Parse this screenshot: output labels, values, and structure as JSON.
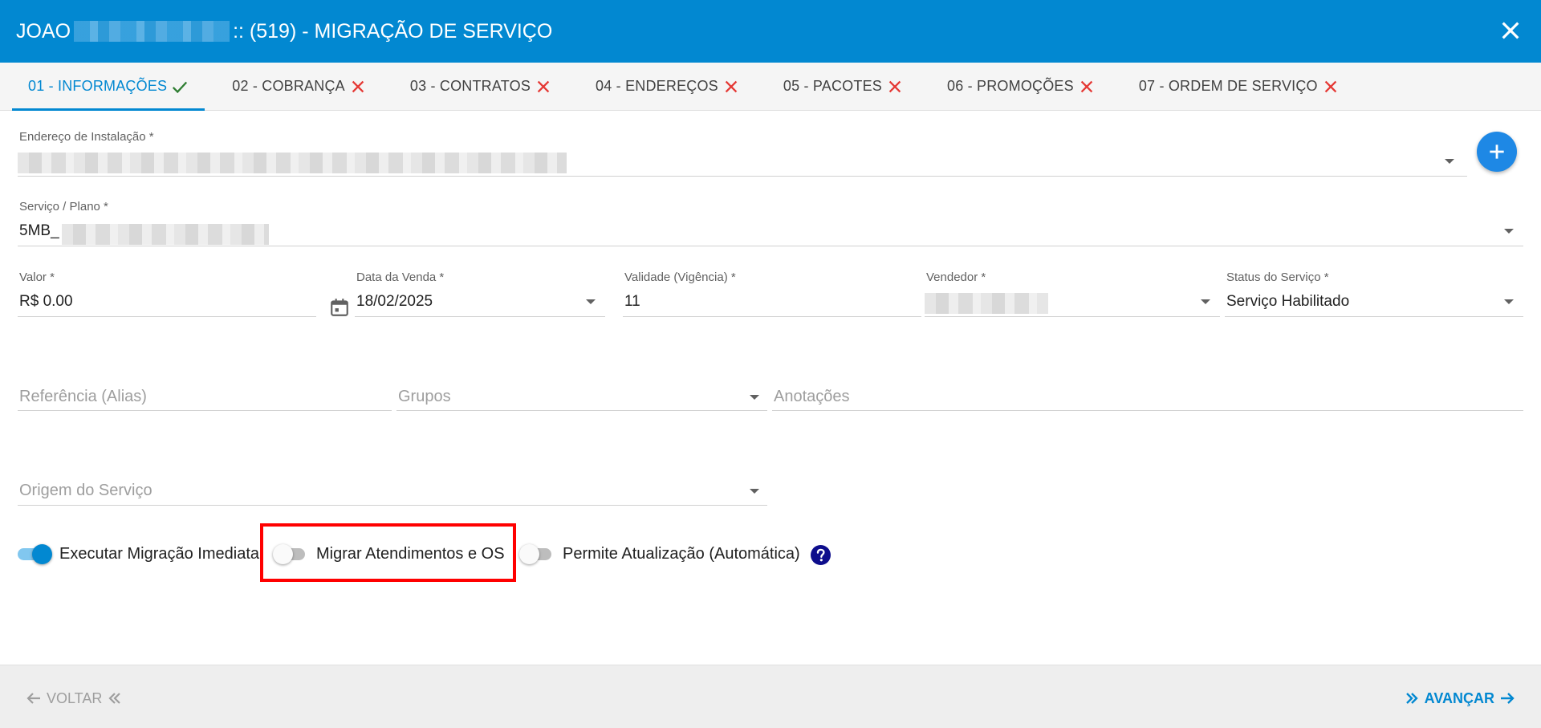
{
  "header": {
    "title_prefix": "JOAO",
    "title_suffix": ":: (519) - MIGRAÇÃO DE SERVIÇO"
  },
  "tabs": [
    {
      "label": "01 - INFORMAÇÕES",
      "status": "ok"
    },
    {
      "label": "02 - COBRANÇA",
      "status": "error"
    },
    {
      "label": "03 - CONTRATOS",
      "status": "error"
    },
    {
      "label": "04 - ENDEREÇOS",
      "status": "error"
    },
    {
      "label": "05 - PACOTES",
      "status": "error"
    },
    {
      "label": "06 - PROMOÇÕES",
      "status": "error"
    },
    {
      "label": "07 - ORDEM DE SERVIÇO",
      "status": "error"
    }
  ],
  "form": {
    "endereco": {
      "label": "Endereço de Instalação *",
      "value": ""
    },
    "servico": {
      "label": "Serviço / Plano *",
      "value": "5MB_"
    },
    "valor": {
      "label": "Valor *",
      "value": "R$ 0.00"
    },
    "data_venda": {
      "label": "Data da Venda *",
      "value": "18/02/2025"
    },
    "validade": {
      "label": "Validade (Vigência) *",
      "value": "11"
    },
    "vendedor": {
      "label": "Vendedor *",
      "value": ""
    },
    "status": {
      "label": "Status do Serviço *",
      "value": "Serviço Habilitado"
    },
    "referencia": {
      "placeholder": "Referência (Alias)"
    },
    "grupos": {
      "placeholder": "Grupos"
    },
    "anotacoes": {
      "placeholder": "Anotações"
    },
    "origem": {
      "placeholder": "Origem do Serviço"
    }
  },
  "toggles": [
    {
      "label": "Executar Migração Imediata",
      "on": true
    },
    {
      "label": "Migrar Atendimentos e OS",
      "on": false
    },
    {
      "label": "Permite Atualização (Automática)",
      "on": false
    }
  ],
  "footer": {
    "back_label": "VOLTAR",
    "next_label": "AVANÇAR"
  },
  "colors": {
    "primary": "#0288d1",
    "error": "#e53935",
    "success": "#2e7d32",
    "highlight": "#ff0000"
  }
}
